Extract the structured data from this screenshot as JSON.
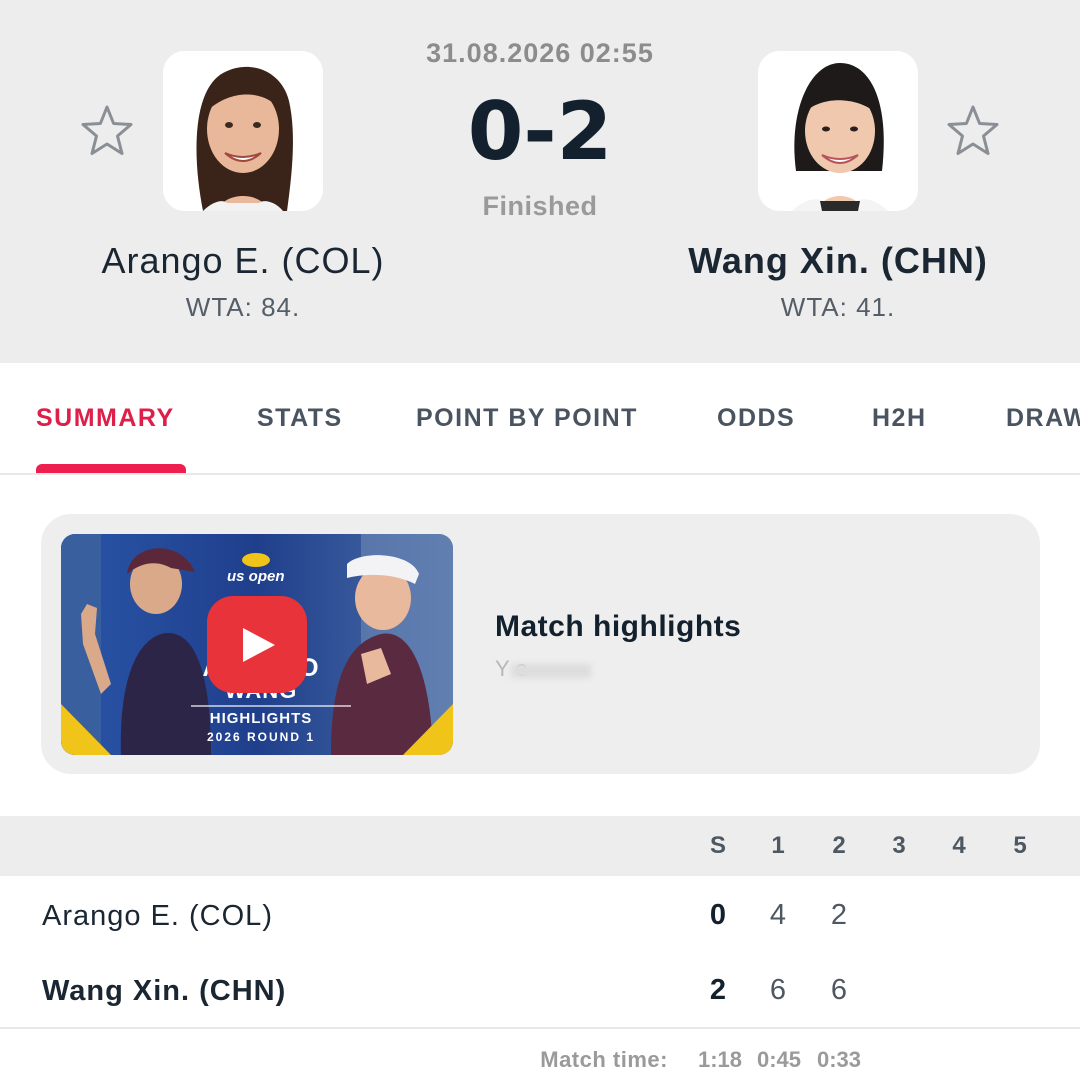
{
  "match": {
    "datetime": "31.08.2026 02:55",
    "score": "0-2",
    "status": "Finished"
  },
  "players": {
    "home": {
      "name": "Arango E. (COL)",
      "rank": "WTA: 84.",
      "favorite_icon": "star-outline-icon"
    },
    "away": {
      "name": "Wang Xin. (CHN)",
      "rank": "WTA: 41.",
      "favorite_icon": "star-outline-icon"
    }
  },
  "tabs": [
    {
      "label": "SUMMARY",
      "active": true
    },
    {
      "label": "STATS",
      "active": false
    },
    {
      "label": "POINT BY POINT",
      "active": false
    },
    {
      "label": "ODDS",
      "active": false
    },
    {
      "label": "H2H",
      "active": false
    },
    {
      "label": "DRAW",
      "active": false
    }
  ],
  "highlights": {
    "title": "Match highlights",
    "source": "Y            e",
    "thumbnail": {
      "brand": "us open",
      "name_top": "ARANGO",
      "name_bottom": "WANG",
      "title": "HIGHLIGHTS",
      "subtitle": "2026 ROUND 1"
    },
    "play_icon": "play-icon"
  },
  "scoreboard": {
    "columns": [
      "S",
      "1",
      "2",
      "3",
      "4",
      "5"
    ],
    "rows": [
      {
        "name": "Arango E. (COL)",
        "sets": "0",
        "set_scores": [
          "4",
          "2"
        ],
        "winner": false
      },
      {
        "name": "Wang Xin. (CHN)",
        "sets": "2",
        "set_scores": [
          "6",
          "6"
        ],
        "winner": true
      }
    ],
    "match_time_label": "Match time:",
    "match_time_values": [
      "1:18",
      "0:45",
      "0:33"
    ]
  },
  "colors": {
    "accent": "#ee1e4f",
    "header_bg": "#ededed",
    "play_button": "#e8333a"
  }
}
